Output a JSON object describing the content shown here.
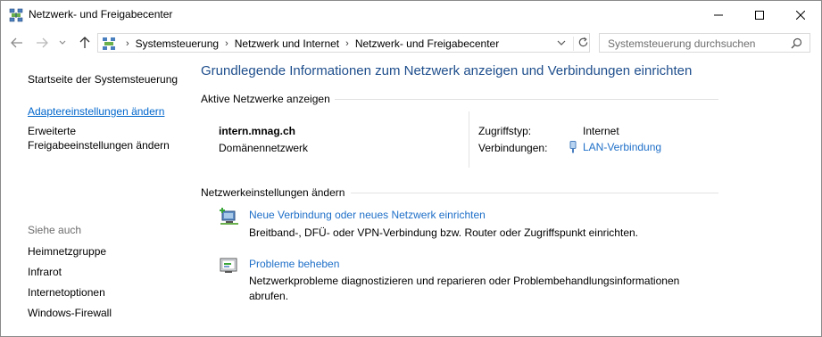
{
  "window": {
    "title": "Netzwerk- und Freigabecenter",
    "app_icon": "network-icon"
  },
  "nav": {
    "breadcrumbs": [
      "Systemsteuerung",
      "Netzwerk und Internet",
      "Netzwerk- und Freigabecenter"
    ],
    "search_placeholder": "Systemsteuerung durchsuchen"
  },
  "sidebar": {
    "home": "Startseite der Systemsteuerung",
    "adapter": "Adaptereinstellungen ändern",
    "sharing_line1": "Erweiterte",
    "sharing_line2": "Freigabeeinstellungen ändern",
    "see_also_heading": "Siehe auch",
    "see_also": [
      "Heimnetzgruppe",
      "Infrarot",
      "Internetoptionen",
      "Windows-Firewall"
    ]
  },
  "main": {
    "heading": "Grundlegende Informationen zum Netzwerk anzeigen und Verbindungen einrichten",
    "active_section": "Aktive Netzwerke anzeigen",
    "network": {
      "name": "intern.mnag.ch",
      "type": "Domänennetzwerk",
      "access_label": "Zugriffstyp:",
      "access_value": "Internet",
      "connections_label": "Verbindungen:",
      "connections_value": "LAN-Verbindung"
    },
    "change_section": "Netzwerkeinstellungen ändern",
    "tasks": [
      {
        "title": "Neue Verbindung oder neues Netzwerk einrichten",
        "desc": "Breitband-, DFÜ- oder VPN-Verbindung bzw. Router oder Zugriffspunkt einrichten."
      },
      {
        "title": "Probleme beheben",
        "desc": "Netzwerkprobleme diagnostizieren und reparieren oder Problembehandlungsinformationen abrufen."
      }
    ]
  }
}
